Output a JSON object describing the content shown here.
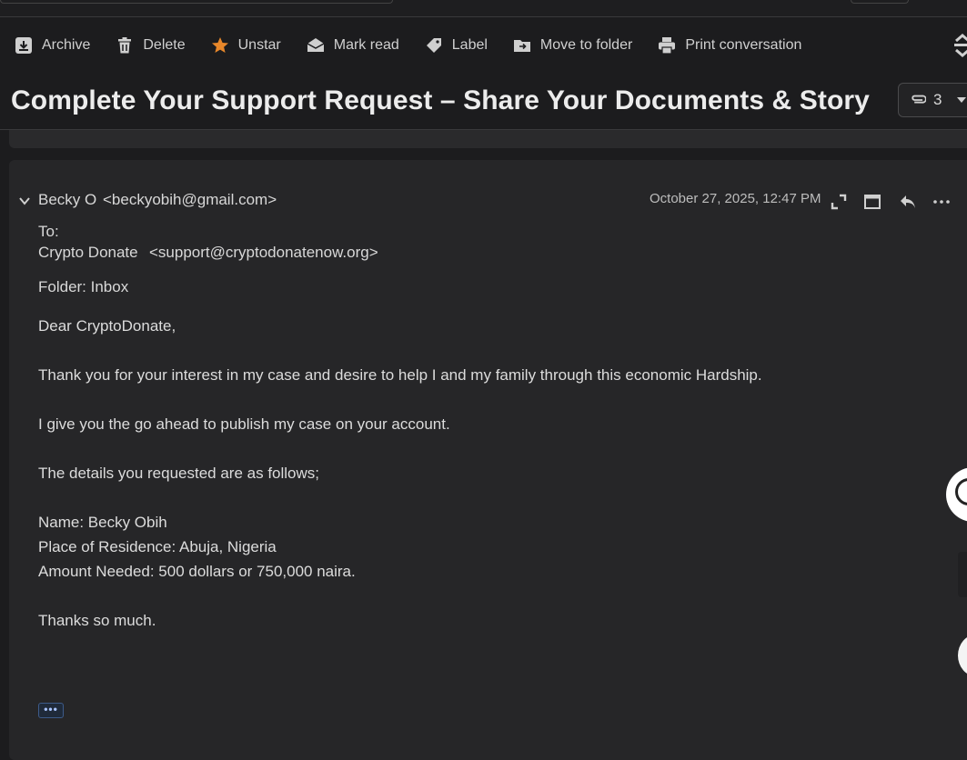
{
  "toolbar": {
    "archive": "Archive",
    "delete": "Delete",
    "unstar": "Unstar",
    "mark_read": "Mark read",
    "label": "Label",
    "move_to_folder": "Move to folder",
    "print_conversation": "Print conversation"
  },
  "conversation": {
    "subject": "Complete Your Support Request – Share Your Documents & Story",
    "attachment_count": "3"
  },
  "message": {
    "sender_name": "Becky O",
    "sender_email": "<beckyobih@gmail.com>",
    "date": "October 27, 2025, 12:47 PM",
    "to_label": "To:",
    "recipient_name": "Crypto Donate",
    "recipient_email": "<support@cryptodonatenow.org>",
    "folder": "Folder: Inbox",
    "body": {
      "greeting": "Dear CryptoDonate,",
      "p1": "Thank you for your interest in my case and desire to help I and my family through this economic Hardship.",
      "p2": "I give you the go ahead to publish my case on your account.",
      "p3": "The details you requested are as follows;",
      "name": "Name: Becky Obih",
      "residence": "Place of Residence: Abuja, Nigeria",
      "amount": "Amount Needed: 500 dollars or 750,000 naira.",
      "closing": "Thanks so much."
    },
    "more_button": "•••"
  },
  "colors": {
    "background": "#1c1c1e",
    "card": "#262628",
    "star_accent": "#e8872a",
    "more_button_text": "#a9c4ff"
  },
  "icons": [
    "archive-icon",
    "trash-icon",
    "star-icon",
    "envelope-open-icon",
    "tag-icon",
    "folder-move-icon",
    "printer-icon",
    "paperclip-icon",
    "chevron-down-icon",
    "expand-icon",
    "window-icon",
    "reply-icon",
    "more-icon"
  ]
}
